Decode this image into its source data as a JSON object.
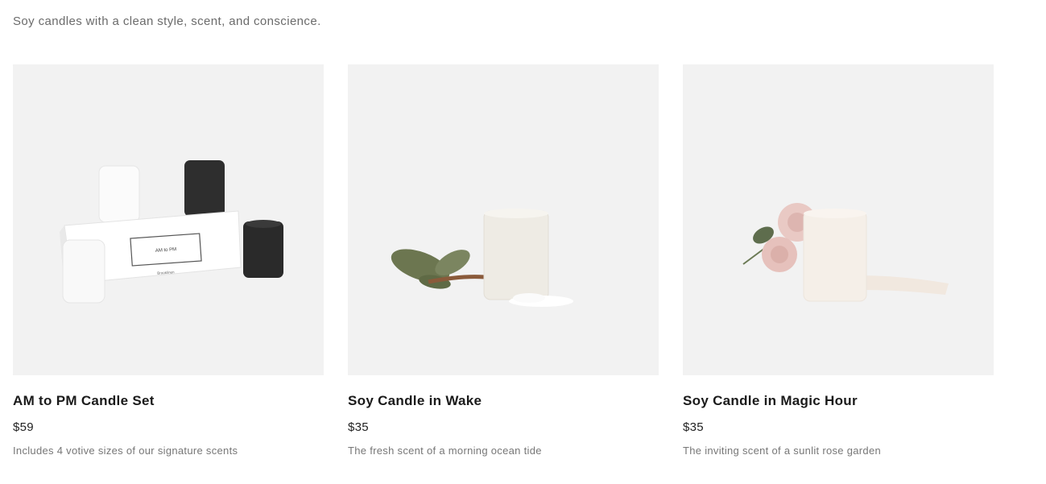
{
  "header": {
    "tagline": "Soy candles with a clean style, scent, and conscience."
  },
  "products": [
    {
      "title": "AM to PM Candle Set",
      "price": "$59",
      "description": "Includes 4 votive sizes of our signature scents",
      "image_icon": "candle-set-image",
      "box_label": "AM to PM",
      "box_brand": "Brooklinen"
    },
    {
      "title": "Soy Candle in Wake",
      "price": "$35",
      "description": "The fresh scent of a morning ocean tide",
      "image_icon": "candle-wake-image"
    },
    {
      "title": "Soy Candle in Magic Hour",
      "price": "$35",
      "description": "The inviting scent of a sunlit rose garden",
      "image_icon": "candle-magic-hour-image"
    }
  ],
  "colors": {
    "image_background": "#f2f2f2",
    "title": "#1a1a1a",
    "description": "#777777"
  }
}
